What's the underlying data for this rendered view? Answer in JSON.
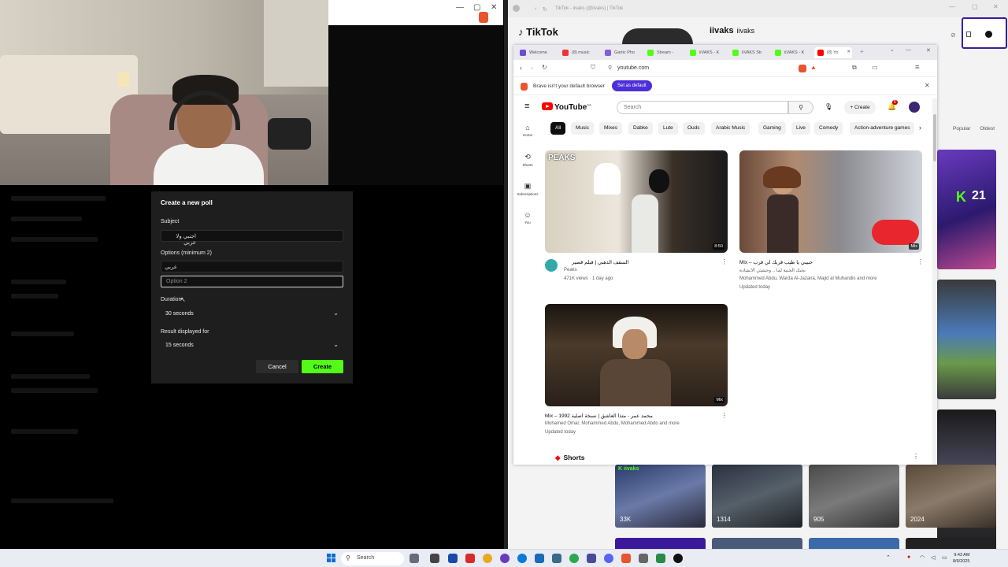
{
  "poll": {
    "title": "Create a new poll",
    "subject_label": "Subject",
    "subject_value": "اجنبي ولا عربي",
    "options_label": "Options (minimum 2)",
    "option1_value": "عربي",
    "option2_placeholder": "Option 2",
    "duration_label": "Duration",
    "duration_value": "30 seconds",
    "result_label": "Result displayed for",
    "result_value": "15 seconds",
    "cancel_label": "Cancel",
    "create_label": "Create"
  },
  "tiktok": {
    "window_title": "TikTok - iivaks (@iivaks) | TikTok",
    "logo": "TikTok",
    "username": "iivaks",
    "handle": "iivaks",
    "tabs": [
      "Popular",
      "Oldest"
    ],
    "side_overlay": "21",
    "bottom_counts": [
      "33K",
      "1314",
      "905",
      "2024"
    ]
  },
  "browser": {
    "tabs": [
      "Welcome",
      "(8) music",
      "Gartic Pho",
      "Stream -",
      "iiVAKS - K",
      "iiVAKS Str",
      "iiVAKS - K",
      "(8) Yo"
    ],
    "url": "youtube.com",
    "notice": "Brave isn't your default browser",
    "set_default": "Set as default"
  },
  "youtube": {
    "logo": "YouTube",
    "logo_sup": "SA",
    "search_placeholder": "Search",
    "create_label": "Create",
    "notif_count": "6",
    "chips": [
      "All",
      "Music",
      "Mixes",
      "Dabke",
      "Lute",
      "Ouds",
      "Arabic Music",
      "Gaming",
      "Live",
      "Comedy",
      "Action-adventure games"
    ],
    "sidebar": [
      "Home",
      "Shorts",
      "Subscriptions",
      "You"
    ],
    "videos": [
      {
        "title": "السقف الذهبي | فيلم قصير",
        "channel": "Peaks",
        "meta": "471K views · 1 day ago",
        "duration": "8:50",
        "badge": "PEAKS"
      },
      {
        "title": "Mix – حبيبي يا طيب قربك لي قرب",
        "channel_line": "بحبك الجنية لما .. وحشتي الانشادة",
        "meta": "Mohammed Abdu, Warda Al-Jazaira, Majid al Muhandis and more",
        "updated": "Updated today",
        "duration": "Mix"
      },
      {
        "title": "Mix – 1992 محمد عمر - متذا العاشق | نسخة اصلية",
        "meta": "Mohamed Omar, Mohammed Abdu, Mohammed Abdo and more",
        "updated": "Updated today",
        "duration": "Mix"
      }
    ],
    "shorts_label": "Shorts"
  },
  "taskbar": {
    "search": "Search",
    "time": "9:43 AM",
    "date": "8/6/2025"
  },
  "colors": {
    "kick_green": "#53fc18",
    "brave_purple": "#4c2fd8",
    "yt_red": "#ff0000"
  }
}
